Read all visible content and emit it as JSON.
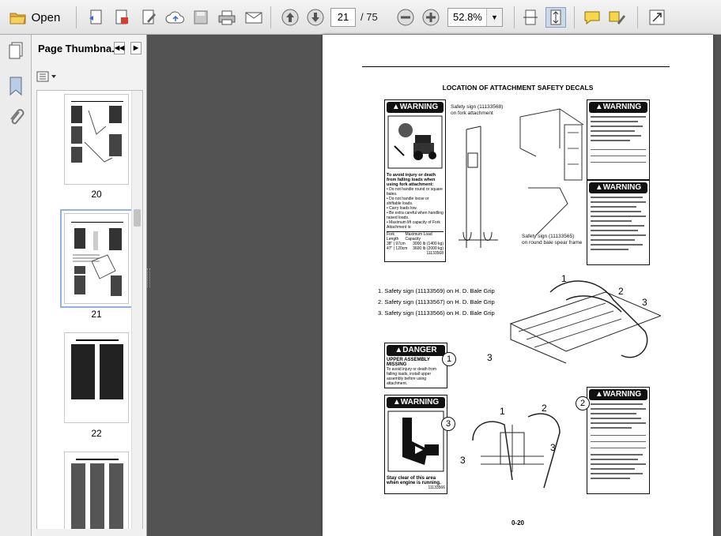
{
  "toolbar": {
    "open_label": "Open",
    "page_current": "21",
    "page_total": "/ 75",
    "zoom": "52.8%"
  },
  "panel": {
    "title": "Page Thumbna...",
    "thumbnails": [
      {
        "label": "20"
      },
      {
        "label": "21"
      },
      {
        "label": "22"
      }
    ]
  },
  "doc": {
    "title": "LOCATION OF ATTACHMENT SAFETY DECALS",
    "warning_word": "WARNING",
    "danger_word": "DANGER",
    "caption_fork": "Safety sign (11133568)\non fork attachment",
    "caption_spear": "Safety sign (11133565)\non round bale spear frame",
    "decal1_text": "To avoid injury or death from falling loads when using fork attachment:",
    "decal1_bullets": [
      "Do not handle round or square bales.",
      "Do not handle loose or shiftable loads.",
      "Carry loads low.",
      "Be extra careful when handling raised loads.",
      "Maximum lift capacity of Fork Attachment is:"
    ],
    "decal1_table_head": [
      "Fork Length",
      "Maximum Load Capacity"
    ],
    "decal1_rows": [
      [
        "38\" | 97cm",
        "3000 lb (1400 kg)"
      ],
      [
        "47\" | 120cm",
        "3600 lb (2000 kg)"
      ]
    ],
    "decal1_code": "11133568",
    "items": [
      "1.   Safety sign (11133569) on H. D. Bale Grip",
      "2.   Safety sign (11133567) on H. D. Bale Grip",
      "3.   Safety sign (11133566) on H. D. Bale Grip"
    ],
    "danger_sub": "UPPER ASSEMBLY MISSING",
    "danger_text": "To avoid injury or death from falling loads, install upper assembly before using attachment.",
    "warning3_text": "Stay clear of this area when engine is running.",
    "warning3_code": "11133566",
    "callouts": [
      "1",
      "2",
      "3"
    ],
    "page_number": "0-20"
  }
}
